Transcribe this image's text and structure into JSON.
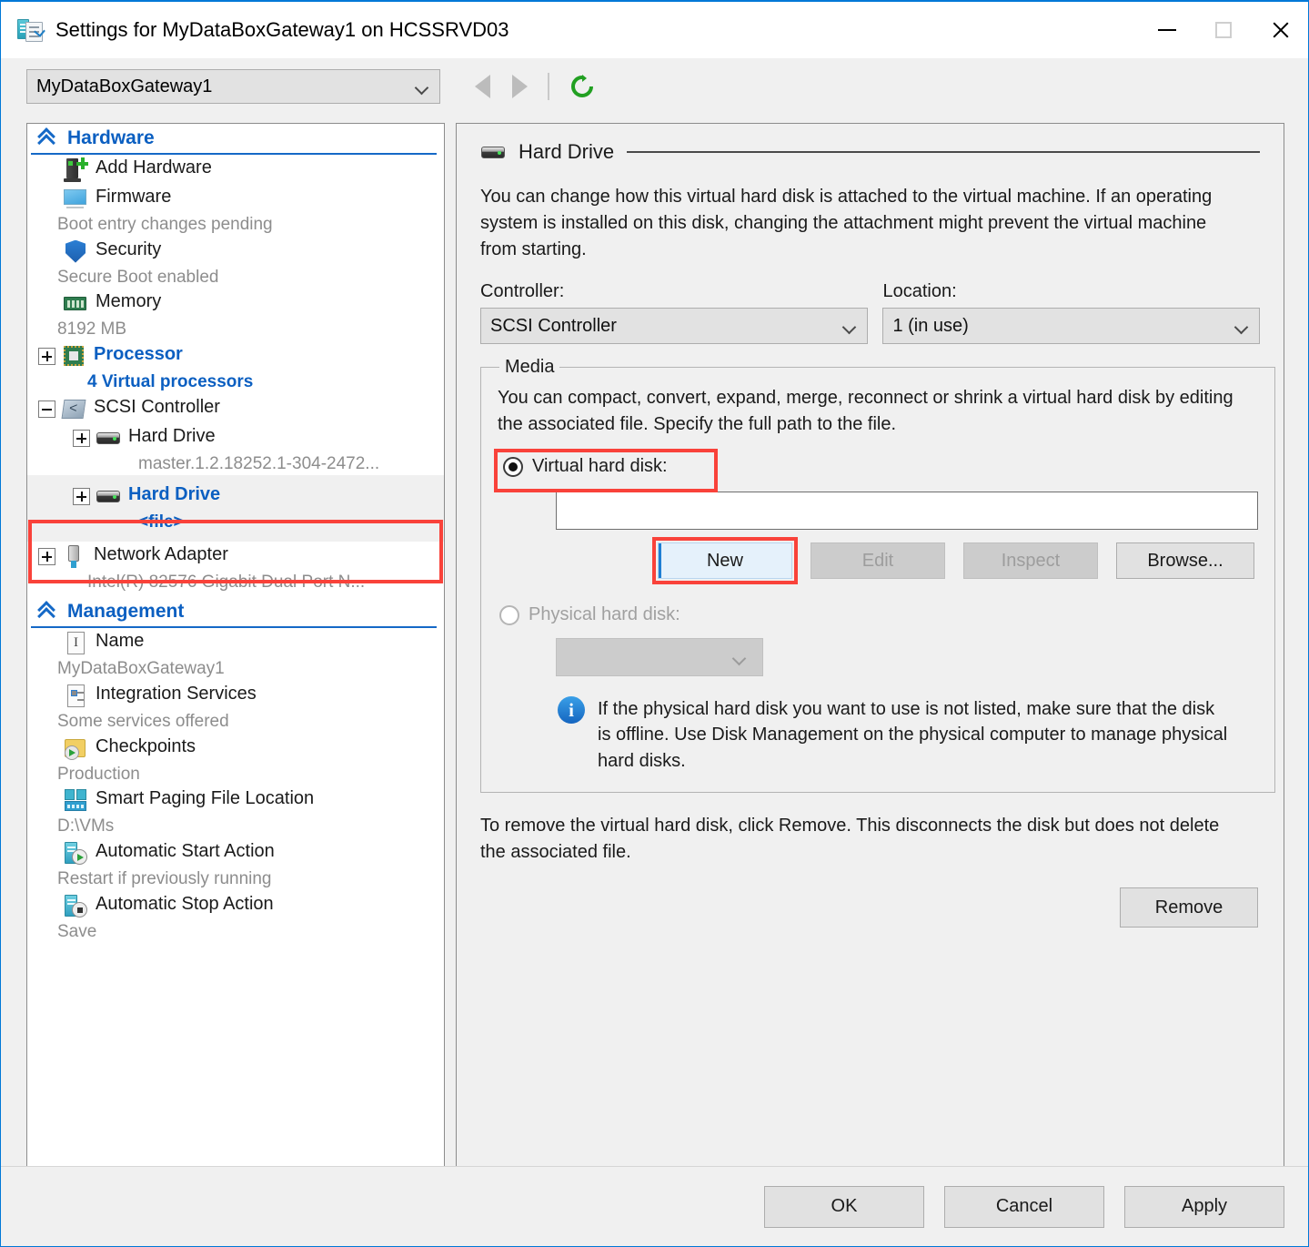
{
  "window": {
    "title": "Settings for MyDataBoxGateway1 on HCSSRVD03",
    "icon": "settings-vm-icon",
    "minimize_label": "Minimize",
    "maximize_label": "Maximize",
    "close_label": "Close"
  },
  "toolbar": {
    "vm_selector_value": "MyDataBoxGateway1",
    "back_label": "Back",
    "forward_label": "Forward",
    "refresh_label": "Refresh"
  },
  "tree": {
    "hardware": {
      "header": "Hardware",
      "items": [
        {
          "title": "Add Hardware",
          "sub": "",
          "icon": "add-hardware-icon",
          "expander": "none",
          "selected": false,
          "link": false
        },
        {
          "title": "Firmware",
          "sub": "Boot entry changes pending",
          "icon": "firmware-monitor-icon",
          "expander": "none",
          "selected": false,
          "link": false
        },
        {
          "title": "Security",
          "sub": "Secure Boot enabled",
          "icon": "shield-icon",
          "expander": "none",
          "selected": false,
          "link": false
        },
        {
          "title": "Memory",
          "sub": "8192 MB",
          "icon": "memory-icon",
          "expander": "none",
          "selected": false,
          "link": false
        },
        {
          "title": "Processor",
          "sub": "4 Virtual processors",
          "icon": "processor-icon",
          "expander": "plus",
          "selected": false,
          "link": true
        },
        {
          "title": "SCSI Controller",
          "sub": "",
          "icon": "scsi-controller-icon",
          "expander": "minus",
          "selected": false,
          "link": false
        },
        {
          "title": "Hard Drive",
          "sub": "master.1.2.18252.1-304-2472...",
          "icon": "hard-drive-icon",
          "expander": "plus",
          "selected": false,
          "link": false,
          "child": true
        },
        {
          "title": "Hard Drive",
          "sub": "<file>",
          "icon": "hard-drive-icon",
          "expander": "plus",
          "selected": true,
          "link": true,
          "child": true
        },
        {
          "title": "Network Adapter",
          "sub": "Intel(R) 82576 Gigabit Dual Port N...",
          "icon": "network-adapter-icon",
          "expander": "plus",
          "selected": false,
          "link": false
        }
      ]
    },
    "management": {
      "header": "Management",
      "items": [
        {
          "title": "Name",
          "sub": "MyDataBoxGateway1",
          "icon": "name-icon"
        },
        {
          "title": "Integration Services",
          "sub": "Some services offered",
          "icon": "integration-services-icon"
        },
        {
          "title": "Checkpoints",
          "sub": "Production",
          "icon": "checkpoints-icon"
        },
        {
          "title": "Smart Paging File Location",
          "sub": "D:\\VMs",
          "icon": "smart-paging-icon"
        },
        {
          "title": "Automatic Start Action",
          "sub": "Restart if previously running",
          "icon": "auto-start-icon"
        },
        {
          "title": "Automatic Stop Action",
          "sub": "Save",
          "icon": "auto-stop-icon"
        }
      ]
    }
  },
  "detail": {
    "header_title": "Hard Drive",
    "header_icon": "hard-drive-icon",
    "description": "You can change how this virtual hard disk is attached to the virtual machine. If an operating system is installed on this disk, changing the attachment might prevent the virtual machine from starting.",
    "controller_label": "Controller:",
    "controller_value": "SCSI Controller",
    "location_label": "Location:",
    "location_value": "1 (in use)",
    "media": {
      "legend": "Media",
      "description": "You can compact, convert, expand, merge, reconnect or shrink a virtual hard disk by editing the associated file. Specify the full path to the file.",
      "virtual_radio_label": "Virtual hard disk:",
      "virtual_radio_checked": true,
      "vhd_path_value": "",
      "buttons": {
        "new": "New",
        "edit": "Edit",
        "inspect": "Inspect",
        "browse": "Browse..."
      },
      "physical_radio_label": "Physical hard disk:",
      "physical_radio_checked": false,
      "physical_select_value": "",
      "info_icon": "info-icon",
      "info_text": "If the physical hard disk you want to use is not listed, make sure that the disk is offline. Use Disk Management on the physical computer to manage physical hard disks."
    },
    "remove_note": "To remove the virtual hard disk, click Remove. This disconnects the disk but does not delete the associated file.",
    "remove_button": "Remove"
  },
  "footer": {
    "ok": "OK",
    "cancel": "Cancel",
    "apply": "Apply"
  },
  "colors": {
    "accent_blue": "#0b5fc1",
    "annotation_red": "#f9423a",
    "hover_blue": "#e5f1fb",
    "refresh_green": "#22a022"
  }
}
